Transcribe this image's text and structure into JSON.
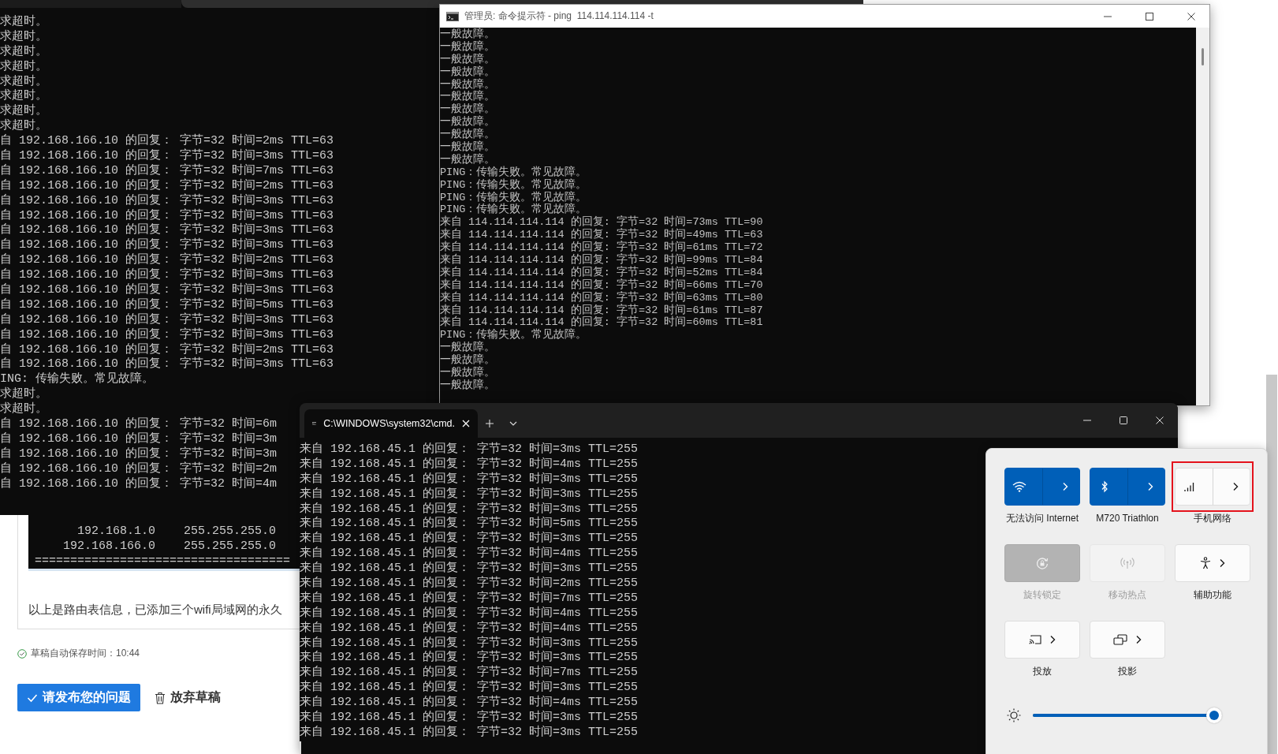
{
  "left_terminal": {
    "lines": [
      "求超时。",
      "求超时。",
      "求超时。",
      "求超时。",
      "求超时。",
      "求超时。",
      "求超时。",
      "求超时。",
      "自 192.168.166.10 的回复： 字节=32 时间=2ms TTL=63",
      "自 192.168.166.10 的回复： 字节=32 时间=3ms TTL=63",
      "自 192.168.166.10 的回复： 字节=32 时间=7ms TTL=63",
      "自 192.168.166.10 的回复： 字节=32 时间=2ms TTL=63",
      "自 192.168.166.10 的回复： 字节=32 时间=3ms TTL=63",
      "自 192.168.166.10 的回复： 字节=32 时间=3ms TTL=63",
      "自 192.168.166.10 的回复： 字节=32 时间=3ms TTL=63",
      "自 192.168.166.10 的回复： 字节=32 时间=3ms TTL=63",
      "自 192.168.166.10 的回复： 字节=32 时间=2ms TTL=63",
      "自 192.168.166.10 的回复： 字节=32 时间=3ms TTL=63",
      "自 192.168.166.10 的回复： 字节=32 时间=3ms TTL=63",
      "自 192.168.166.10 的回复： 字节=32 时间=5ms TTL=63",
      "自 192.168.166.10 的回复： 字节=32 时间=3ms TTL=63",
      "自 192.168.166.10 的回复： 字节=32 时间=3ms TTL=63",
      "自 192.168.166.10 的回复： 字节=32 时间=2ms TTL=63",
      "自 192.168.166.10 的回复： 字节=32 时间=3ms TTL=63",
      "ING: 传输失败。常见故障。",
      "求超时。",
      "求超时。",
      "自 192.168.166.10 的回复： 字节=32 时间=6m",
      "自 192.168.166.10 的回复： 字节=32 时间=3m",
      "自 192.168.166.10 的回复： 字节=32 时间=3m",
      "自 192.168.166.10 的回复： 字节=32 时间=2m",
      "自 192.168.166.10 的回复： 字节=32 时间=4m"
    ]
  },
  "web_page": {
    "routes": [
      {
        "network": "192.168.1.0",
        "mask": "255.255.255.0"
      },
      {
        "network": "192.168.166.0",
        "mask": "255.255.255.0"
      }
    ],
    "separator": "====================================",
    "paragraph": "以上是路由表信息，已添加三个wifi局域网的永久",
    "autosave": "草稿自动保存时间：10:44",
    "publish_button": "请发布您的问题",
    "discard_button": "放弃草稿"
  },
  "console_window": {
    "title": "管理员: 命令提示符 - ping  114.114.114.114 -t",
    "lines": [
      "一般故障。",
      "一般故障。",
      "一般故障。",
      "一般故障。",
      "一般故障。",
      "一般故障。",
      "一般故障。",
      "一般故障。",
      "一般故障。",
      "一般故障。",
      "一般故障。",
      "PING：传输失败。常见故障。",
      "PING：传输失败。常见故障。",
      "PING：传输失败。常见故障。",
      "PING：传输失败。常见故障。",
      "来自 114.114.114.114 的回复: 字节=32 时间=73ms TTL=90",
      "来自 114.114.114.114 的回复: 字节=32 时间=49ms TTL=63",
      "来自 114.114.114.114 的回复: 字节=32 时间=61ms TTL=72",
      "来自 114.114.114.114 的回复: 字节=32 时间=99ms TTL=84",
      "来自 114.114.114.114 的回复: 字节=32 时间=52ms TTL=84",
      "来自 114.114.114.114 的回复: 字节=32 时间=66ms TTL=70",
      "来自 114.114.114.114 的回复: 字节=32 时间=63ms TTL=80",
      "来自 114.114.114.114 的回复: 字节=32 时间=61ms TTL=87",
      "来自 114.114.114.114 的回复: 字节=32 时间=60ms TTL=81",
      "PING：传输失败。常见故障。",
      "一般故障。",
      "一般故障。",
      "一般故障。",
      "一般故障。"
    ]
  },
  "terminal_window": {
    "tab_title": "C:\\WINDOWS\\system32\\cmd.",
    "lines": [
      "来自 192.168.45.1 的回复： 字节=32 时间=3ms TTL=255",
      "来自 192.168.45.1 的回复： 字节=32 时间=4ms TTL=255",
      "来自 192.168.45.1 的回复： 字节=32 时间=3ms TTL=255",
      "来自 192.168.45.1 的回复： 字节=32 时间=3ms TTL=255",
      "来自 192.168.45.1 的回复： 字节=32 时间=3ms TTL=255",
      "来自 192.168.45.1 的回复： 字节=32 时间=5ms TTL=255",
      "来自 192.168.45.1 的回复： 字节=32 时间=3ms TTL=255",
      "来自 192.168.45.1 的回复： 字节=32 时间=4ms TTL=255",
      "来自 192.168.45.1 的回复： 字节=32 时间=3ms TTL=255",
      "来自 192.168.45.1 的回复： 字节=32 时间=2ms TTL=255",
      "来自 192.168.45.1 的回复： 字节=32 时间=7ms TTL=255",
      "来自 192.168.45.1 的回复： 字节=32 时间=4ms TTL=255",
      "来自 192.168.45.1 的回复： 字节=32 时间=4ms TTL=255",
      "来自 192.168.45.1 的回复： 字节=32 时间=3ms TTL=255",
      "来自 192.168.45.1 的回复： 字节=32 时间=3ms TTL=255",
      "来自 192.168.45.1 的回复： 字节=32 时间=7ms TTL=255",
      "来自 192.168.45.1 的回复： 字节=32 时间=3ms TTL=255",
      "来自 192.168.45.1 的回复： 字节=32 时间=4ms TTL=255",
      "来自 192.168.45.1 的回复： 字节=32 时间=3ms TTL=255",
      "来自 192.168.45.1 的回复： 字节=32 时间=3ms TTL=255"
    ]
  },
  "quick_settings": {
    "tiles": [
      {
        "kind": "split",
        "label": "无法访问 Internet",
        "on": true,
        "disabled": false,
        "highlighted": false
      },
      {
        "kind": "split",
        "label": "M720 Triathlon",
        "on": true,
        "disabled": false,
        "highlighted": false
      },
      {
        "kind": "split",
        "label": "手机网络",
        "on": false,
        "disabled": false,
        "highlighted": true
      },
      {
        "kind": "plain",
        "label": "旋转锁定",
        "on": true,
        "disabled": true,
        "highlighted": false
      },
      {
        "kind": "plain",
        "label": "移动热点",
        "on": false,
        "disabled": true,
        "highlighted": false
      },
      {
        "kind": "chevron",
        "label": "辅助功能",
        "on": false,
        "disabled": false,
        "highlighted": false
      },
      {
        "kind": "chevron",
        "label": "投放",
        "on": false,
        "disabled": false,
        "highlighted": false
      },
      {
        "kind": "chevron",
        "label": "投影",
        "on": false,
        "disabled": false,
        "highlighted": false
      }
    ],
    "brightness": {
      "level": 0.96
    }
  }
}
